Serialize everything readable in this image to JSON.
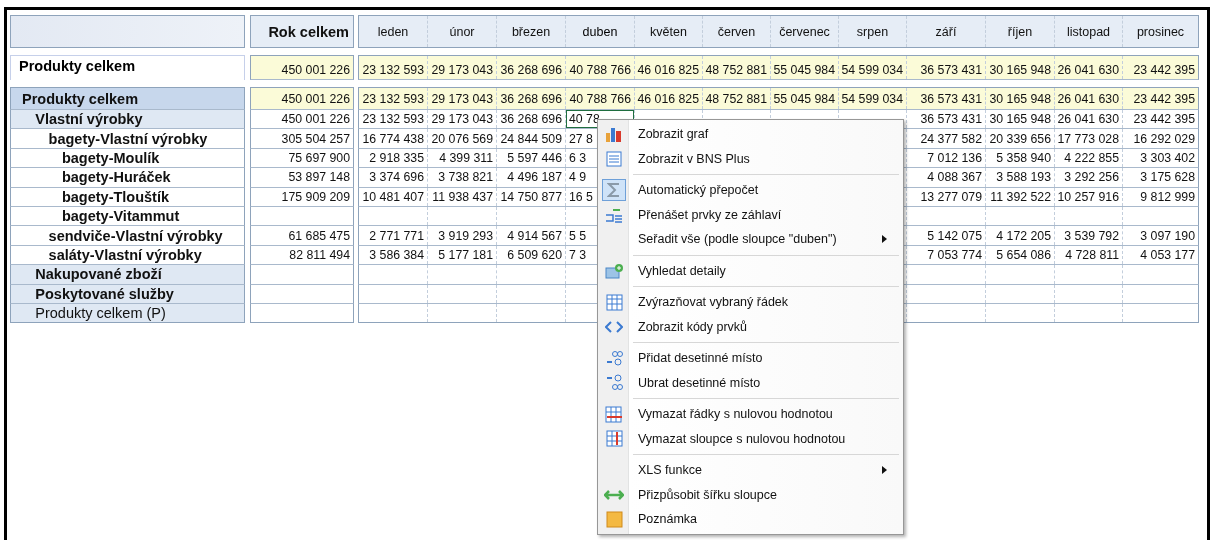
{
  "header": {
    "total_label": "Rok celkem",
    "months": [
      {
        "label": "leden",
        "selected": false
      },
      {
        "label": "únor",
        "selected": false
      },
      {
        "label": "březen",
        "selected": false
      },
      {
        "label": "duben",
        "selected": true
      },
      {
        "label": "květen",
        "selected": false
      },
      {
        "label": "červen",
        "selected": false
      },
      {
        "label": "červenec",
        "selected": false
      },
      {
        "label": "srpen",
        "selected": false
      },
      {
        "label": "září",
        "selected": false
      },
      {
        "label": "říjen",
        "selected": false
      },
      {
        "label": "listopad",
        "selected": false
      },
      {
        "label": "prosinec",
        "selected": false
      }
    ]
  },
  "summary": {
    "label": "Produkty celkem",
    "total": "450 001 226",
    "values": [
      "23 132 593",
      "29 173 043",
      "36 268 696",
      "40 788 766",
      "46 016 825",
      "48 752 881",
      "55 045 984",
      "54 599 034",
      "36 573 431",
      "30 165 948",
      "26 041 630",
      "23 442 395"
    ]
  },
  "rows": [
    {
      "label": "Produkty celkem",
      "bold": true,
      "highlighted": true,
      "selected": false,
      "total": "450 001 226",
      "values": [
        "23 132 593",
        "29 173 043",
        "36 268 696",
        "40 788 766",
        "46 016 825",
        "48 752 881",
        "55 045 984",
        "54 599 034",
        "36 573 431",
        "30 165 948",
        "26 041 630",
        "23 442 395"
      ],
      "children": [
        {
          "label": "Vlastní výrobky",
          "bold": true,
          "highlighted": false,
          "selected": true,
          "total": "450 001 226",
          "values": [
            "23 132 593",
            "29 173 043",
            "36 268 696",
            "40 78"
          ],
          "values_after_menu": [
            "36 573 431",
            "30 165 948",
            "26 041 630",
            "23 442 395"
          ],
          "children": [
            {
              "label": "bagety-Vlastní výrobky",
              "bold": true,
              "highlighted": false,
              "selected": false,
              "total": "305 504 257",
              "values": [
                "16 774 438",
                "20 076 569",
                "24 844 509",
                "27 8"
              ],
              "values_after_menu": [
                "24 377 582",
                "20 339 656",
                "17 773 028",
                "16 292 029"
              ],
              "children": [
                {
                  "label": "bagety-Moulík",
                  "bold": true,
                  "highlighted": false,
                  "selected": false,
                  "total": "75 697 900",
                  "values": [
                    "2 918 335",
                    "4 399 311",
                    "5 597 446",
                    "6 3"
                  ],
                  "values_after_menu": [
                    "7 012 136",
                    "5 358 940",
                    "4 222 855",
                    "3 303 402"
                  ]
                },
                {
                  "label": "bagety-Huráček",
                  "bold": true,
                  "highlighted": false,
                  "selected": false,
                  "total": "53 897 148",
                  "values": [
                    "3 374 696",
                    "3 738 821",
                    "4 496 187",
                    "4 9"
                  ],
                  "values_after_menu": [
                    "4 088 367",
                    "3 588 193",
                    "3 292 256",
                    "3 175 628"
                  ]
                },
                {
                  "label": "bagety-Tlouštík",
                  "bold": true,
                  "highlighted": false,
                  "selected": false,
                  "total": "175 909 209",
                  "values": [
                    "10 481 407",
                    "11 938 437",
                    "14 750 877",
                    "16 5"
                  ],
                  "values_after_menu": [
                    "13 277 079",
                    "11 392 522",
                    "10 257 916",
                    "9 812 999"
                  ]
                },
                {
                  "label": "bagety-Vitammut",
                  "bold": true,
                  "highlighted": false,
                  "selected": false
                }
              ]
            },
            {
              "label": "sendviče-Vlastní výrobky",
              "bold": true,
              "highlighted": false,
              "selected": false,
              "total": "61 685 475",
              "values": [
                "2 771 771",
                "3 919 293",
                "4 914 567",
                "5 5"
              ],
              "values_after_menu": [
                "5 142 075",
                "4 172 205",
                "3 539 792",
                "3 097 190"
              ]
            },
            {
              "label": "saláty-Vlastní výrobky",
              "bold": true,
              "highlighted": false,
              "selected": false,
              "total": "82 811 494",
              "values": [
                "3 586 384",
                "5 177 181",
                "6 509 620",
                "7 3"
              ],
              "values_after_menu": [
                "7 053 774",
                "5 654 086",
                "4 728 811",
                "4 053 177"
              ]
            }
          ]
        },
        {
          "label": "Nakupované zboží",
          "bold": true,
          "highlighted": false,
          "selected": false
        },
        {
          "label": "Poskytované služby",
          "bold": true,
          "highlighted": false,
          "selected": false
        },
        {
          "label": "Produkty celkem (P)",
          "bold": false,
          "highlighted": false,
          "selected": false
        }
      ]
    }
  ],
  "context_menu": {
    "groups": [
      [
        {
          "label": "Zobrazit graf",
          "checked": false,
          "submenu": false
        },
        {
          "label": "Zobrazit v BNS Plus",
          "checked": false,
          "submenu": false
        }
      ],
      [
        {
          "label": "Automatický přepočet",
          "checked": true,
          "submenu": false
        },
        {
          "label": "Přenášet prvky ze záhlaví",
          "checked": false,
          "submenu": false
        },
        {
          "label": "Seřadit vše (podle sloupce \"duben\")",
          "checked": false,
          "submenu": true
        }
      ],
      [
        {
          "label": "Vyhledat detaily",
          "checked": false,
          "submenu": false
        }
      ],
      [
        {
          "label": "Zvýrazňovat vybraný řádek",
          "checked": false,
          "submenu": false
        },
        {
          "label": "Zobrazit kódy prvků",
          "checked": false,
          "submenu": false
        }
      ],
      [
        {
          "label": "Přidat desetinné místo",
          "checked": false,
          "submenu": false
        },
        {
          "label": "Ubrat desetinné místo",
          "checked": false,
          "submenu": false
        }
      ],
      [
        {
          "label": "Vymazat řádky s nulovou hodnotou",
          "checked": false,
          "submenu": false
        },
        {
          "label": "Vymazat sloupce s nulovou hodnotou",
          "checked": false,
          "submenu": false
        }
      ],
      [
        {
          "label": "XLS funkce",
          "checked": false,
          "submenu": true
        },
        {
          "label": "Přizpůsobit šířku sloupce",
          "checked": false,
          "submenu": false
        },
        {
          "label": "Poznámka",
          "checked": false,
          "submenu": false
        }
      ]
    ]
  }
}
